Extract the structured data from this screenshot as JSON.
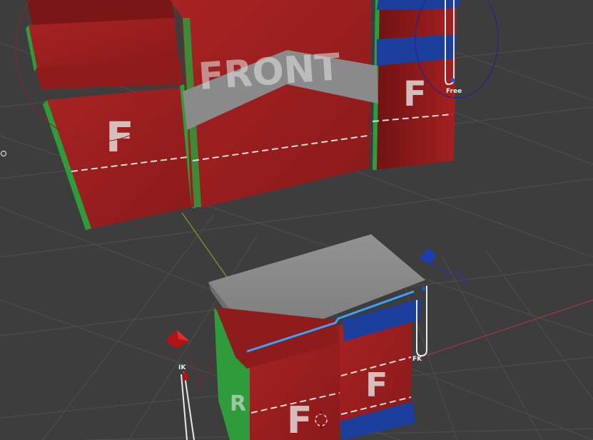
{
  "viewport": {
    "background": "#3d3d3d",
    "grid_color": "#4f4f4f",
    "y_axis_color": "#8a9a2a",
    "x_axis_color": "#9a3b45"
  },
  "rig": {
    "body_face_color": "#9b1e1e",
    "side_green": "#2e9c3a",
    "side_blue": "#1c3f9e",
    "gray_plate": "#8a8a8a",
    "highlight_cyan": "#3aa3ff",
    "body_labels": {
      "front_text": "FRONT",
      "f_center_top": "F",
      "f_left_top": "F",
      "f_right_top": "F",
      "f_front_bottom": "F",
      "f_right_bottom": "F",
      "f_side_bottom": "R"
    }
  },
  "controls": {
    "free_label": "Free",
    "ik_label": "IK",
    "fk_label": "FK"
  }
}
